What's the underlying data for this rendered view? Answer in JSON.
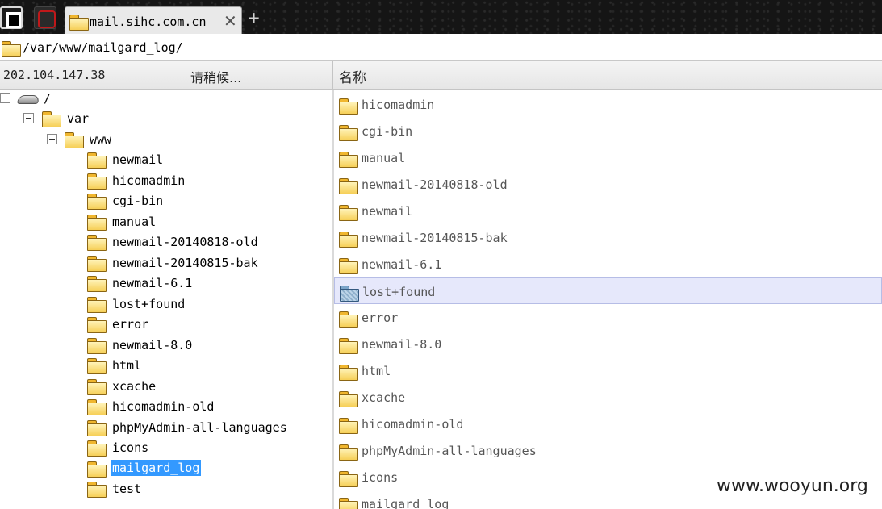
{
  "tabs": [
    {
      "title": ""
    },
    {
      "title": ""
    },
    {
      "title": "mail.sihc.com.cn"
    }
  ],
  "path": "/var/www/mailgard_log/",
  "header": {
    "ip": "202.104.147.38",
    "status": "请稍候...",
    "name_col": "名称"
  },
  "tree": {
    "root": "/",
    "var": "var",
    "www": "www",
    "children": [
      "newmail",
      "hicomadmin",
      "cgi-bin",
      "manual",
      "newmail-20140818-old",
      "newmail-20140815-bak",
      "newmail-6.1",
      "lost+found",
      "error",
      "newmail-8.0",
      "html",
      "xcache",
      "hicomadmin-old",
      "phpMyAdmin-all-languages",
      "icons",
      "mailgard_log",
      "test"
    ],
    "selected": "mailgard_log"
  },
  "files": [
    "hicomadmin",
    "cgi-bin",
    "manual",
    "newmail-20140818-old",
    "newmail",
    "newmail-20140815-bak",
    "newmail-6.1",
    "lost+found",
    "error",
    "newmail-8.0",
    "html",
    "xcache",
    "hicomadmin-old",
    "phpMyAdmin-all-languages",
    "icons",
    "mailgard_log"
  ],
  "selected_file": "lost+found",
  "icons": {
    "folder": "folder-icon",
    "drive": "drive-icon",
    "close": "close-icon",
    "add": "plus-icon"
  },
  "watermark": "www.wooyun.org"
}
